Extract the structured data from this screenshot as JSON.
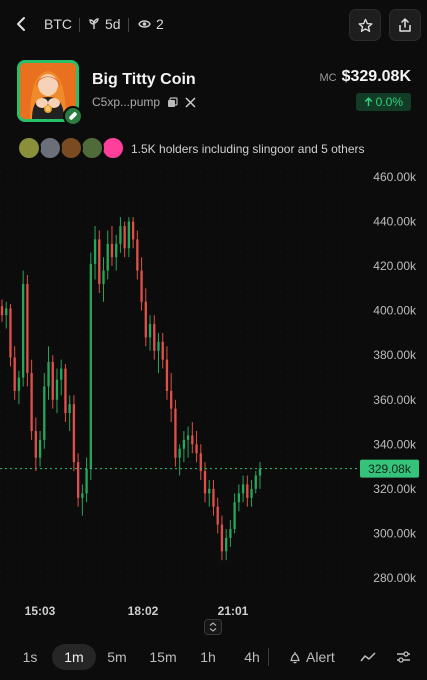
{
  "header": {
    "ticker": "BTC",
    "age": "5d",
    "watchers": "2"
  },
  "token": {
    "name": "Big Titty Coin",
    "address": "C5xp...pump",
    "market_cap_label": "MC",
    "market_cap": "$329.08K",
    "change": "0.0%"
  },
  "holders": {
    "text": "1.5K holders including slingoor and 5 others",
    "avatar_colors": [
      "#8a8f3a",
      "#6b6f7a",
      "#7a4a22",
      "#4f6b3a",
      "#ff3f9a"
    ]
  },
  "chart_data": {
    "type": "candlestick",
    "y_ticks": [
      "460.00k",
      "440.00k",
      "420.00k",
      "400.00k",
      "380.00k",
      "360.00k",
      "340.00k",
      "320.00k",
      "300.00k",
      "280.00k"
    ],
    "ylim": [
      280000,
      460000
    ],
    "x_ticks": [
      "15:03",
      "18:02",
      "21:01"
    ],
    "current_price": 329080,
    "current_price_label": "329.08k",
    "up_color": "#26a65b",
    "down_color": "#e0504a",
    "candles": [
      [
        402000,
        405000,
        395000,
        398000
      ],
      [
        398000,
        404000,
        392000,
        401000
      ],
      [
        401000,
        403000,
        375000,
        379000
      ],
      [
        379000,
        384000,
        360000,
        364000
      ],
      [
        364000,
        373000,
        358000,
        370000
      ],
      [
        370000,
        418000,
        366000,
        412000
      ],
      [
        412000,
        416000,
        366000,
        372000
      ],
      [
        372000,
        378000,
        342000,
        346000
      ],
      [
        346000,
        352000,
        328000,
        334000
      ],
      [
        334000,
        346000,
        330000,
        342000
      ],
      [
        342000,
        372000,
        338000,
        366000
      ],
      [
        366000,
        384000,
        360000,
        377000
      ],
      [
        377000,
        380000,
        356000,
        360000
      ],
      [
        360000,
        374000,
        354000,
        369000
      ],
      [
        369000,
        378000,
        362000,
        374000
      ],
      [
        374000,
        376000,
        350000,
        354000
      ],
      [
        354000,
        362000,
        346000,
        358000
      ],
      [
        358000,
        362000,
        328000,
        332000
      ],
      [
        332000,
        336000,
        312000,
        316000
      ],
      [
        316000,
        322000,
        308000,
        318000
      ],
      [
        318000,
        334000,
        314000,
        329000
      ],
      [
        329000,
        426000,
        324000,
        421000
      ],
      [
        421000,
        438000,
        414000,
        432000
      ],
      [
        432000,
        436000,
        408000,
        412000
      ],
      [
        412000,
        424000,
        404000,
        418000
      ],
      [
        418000,
        436000,
        414000,
        430000
      ],
      [
        430000,
        438000,
        420000,
        424000
      ],
      [
        424000,
        434000,
        418000,
        430000
      ],
      [
        430000,
        442000,
        426000,
        438000
      ],
      [
        438000,
        440000,
        424000,
        428000
      ],
      [
        428000,
        442000,
        424000,
        440000
      ],
      [
        440000,
        442000,
        428000,
        432000
      ],
      [
        432000,
        436000,
        414000,
        418000
      ],
      [
        418000,
        424000,
        400000,
        404000
      ],
      [
        404000,
        410000,
        384000,
        388000
      ],
      [
        388000,
        398000,
        382000,
        394000
      ],
      [
        394000,
        398000,
        378000,
        382000
      ],
      [
        382000,
        390000,
        372000,
        386000
      ],
      [
        386000,
        390000,
        374000,
        378000
      ],
      [
        378000,
        384000,
        360000,
        364000
      ],
      [
        364000,
        372000,
        350000,
        356000
      ],
      [
        356000,
        360000,
        330000,
        334000
      ],
      [
        334000,
        340000,
        326000,
        338000
      ],
      [
        338000,
        346000,
        332000,
        342000
      ],
      [
        342000,
        348000,
        334000,
        344000
      ],
      [
        344000,
        350000,
        336000,
        340000
      ],
      [
        340000,
        346000,
        332000,
        336000
      ],
      [
        336000,
        340000,
        324000,
        328000
      ],
      [
        328000,
        332000,
        314000,
        318000
      ],
      [
        318000,
        324000,
        312000,
        320000
      ],
      [
        320000,
        324000,
        308000,
        312000
      ],
      [
        312000,
        316000,
        300000,
        304000
      ],
      [
        304000,
        308000,
        288000,
        292000
      ],
      [
        292000,
        302000,
        288000,
        298000
      ],
      [
        298000,
        306000,
        294000,
        302000
      ],
      [
        302000,
        318000,
        300000,
        314000
      ],
      [
        314000,
        322000,
        310000,
        318000
      ],
      [
        318000,
        326000,
        314000,
        322000
      ],
      [
        322000,
        326000,
        312000,
        316000
      ],
      [
        316000,
        324000,
        312000,
        320000
      ],
      [
        320000,
        328000,
        318000,
        326000
      ],
      [
        326000,
        332000,
        320000,
        329080
      ]
    ]
  },
  "intervals": {
    "items": [
      "1s",
      "1m",
      "5m",
      "15m",
      "1h",
      "4h"
    ],
    "active": "1m",
    "alert_label": "Alert"
  }
}
